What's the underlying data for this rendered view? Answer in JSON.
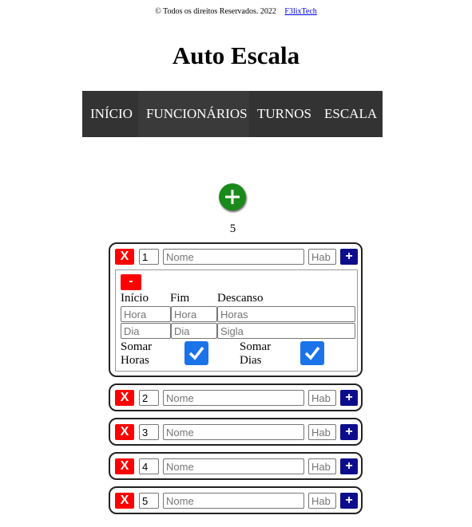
{
  "footer": {
    "copyright": "© Todos os direitos Reservados. 2022",
    "link": "F3lixTech"
  },
  "page": {
    "title": "Auto Escala"
  },
  "nav": {
    "items": [
      "INÍCIO",
      "FUNCIONÁRIOS",
      "TURNOS",
      "ESCALA"
    ]
  },
  "add": {
    "icon": "plus-circle-icon",
    "color": "#1a8a1a"
  },
  "counter": {
    "value": "5"
  },
  "employees": [
    {
      "remove_label": "X",
      "number": "1",
      "name_placeholder": "Nome",
      "hab_placeholder": "Hab",
      "add_label": "+"
    },
    {
      "remove_label": "X",
      "number": "2",
      "name_placeholder": "Nome",
      "hab_placeholder": "Hab",
      "add_label": "+"
    },
    {
      "remove_label": "X",
      "number": "3",
      "name_placeholder": "Nome",
      "hab_placeholder": "Hab",
      "add_label": "+"
    },
    {
      "remove_label": "X",
      "number": "4",
      "name_placeholder": "Nome",
      "hab_placeholder": "Hab",
      "add_label": "+"
    },
    {
      "remove_label": "X",
      "number": "5",
      "name_placeholder": "Nome",
      "hab_placeholder": "Hab",
      "add_label": "+"
    }
  ],
  "shift": {
    "remove_label": "-",
    "col_inicio": "Início",
    "col_fim": "Fim",
    "col_descanso": "Descanso",
    "inicio_hora_placeholder": "Hora",
    "fim_hora_placeholder": "Hora",
    "descanso_horas_placeholder": "Horas",
    "inicio_dia_placeholder": "Dia",
    "fim_dia_placeholder": "Dia",
    "sigla_placeholder": "Sigla",
    "somar_horas_line1": "Somar",
    "somar_horas_line2": "Horas",
    "somar_dias_line1": "Somar",
    "somar_dias_line2": "Dias",
    "somar_horas_checked": true,
    "somar_dias_checked": true
  },
  "colors": {
    "remove": "#ff0000",
    "add": "#0d0d8c",
    "nav_bg": "#333333",
    "checkbox": "#1a73e8"
  }
}
